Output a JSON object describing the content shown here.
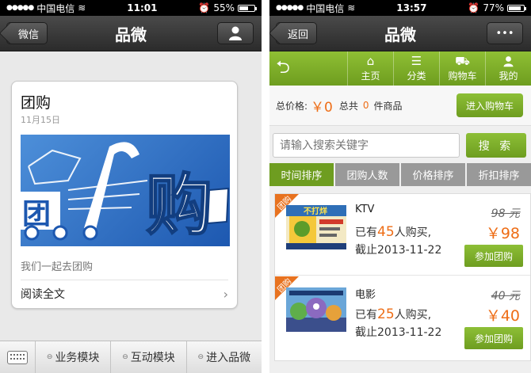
{
  "left_phone": {
    "status_bar": {
      "carrier": "中国电信",
      "time": "11:01",
      "battery_percent": "55%",
      "battery_level": 0.55
    },
    "nav": {
      "back_label": "微信",
      "title": "品微",
      "right_icon": "person-icon"
    },
    "article": {
      "title": "团购",
      "date": "11月15日",
      "banner_text_left": "团",
      "banner_text_right": "购",
      "description": "我们一起去团购",
      "read_more_label": "阅读全文",
      "colors": {
        "banner_blue": "#2a6bc4"
      }
    },
    "bottom_menu": {
      "keyboard_icon": "keyboard-icon",
      "items": [
        {
          "label": "业务模块"
        },
        {
          "label": "互动模块"
        },
        {
          "label": "进入品微"
        }
      ]
    }
  },
  "right_phone": {
    "status_bar": {
      "carrier": "中国电信",
      "time": "13:57",
      "battery_percent": "77%",
      "battery_level": 0.77
    },
    "nav": {
      "back_label": "返回",
      "title": "品微",
      "more_label": "•••"
    },
    "toolbar": {
      "back_icon": "undo-arrow-icon",
      "tabs": [
        {
          "label": "主页",
          "icon": "home-icon"
        },
        {
          "label": "分类",
          "icon": "list-icon"
        },
        {
          "label": "购物车",
          "icon": "cart-icon"
        },
        {
          "label": "我的",
          "icon": "person-icon"
        }
      ]
    },
    "summary": {
      "total_label": "总价格:",
      "total_value": "￥0",
      "count_prefix": "总共",
      "count_value": "0",
      "count_suffix": "件商品",
      "cart_button": "进入购物车"
    },
    "search": {
      "placeholder": "请输入搜索关键字",
      "button": "搜 索"
    },
    "sort_tabs": [
      {
        "label": "时间排序",
        "active": true
      },
      {
        "label": "团购人数",
        "active": false
      },
      {
        "label": "价格排序",
        "active": false
      },
      {
        "label": "折扣排序",
        "active": false
      }
    ],
    "deals": [
      {
        "ribbon": "团购",
        "name": "KTV",
        "buyers_prefix": "已有",
        "buyers_count": "45",
        "buyers_suffix": "人购买,",
        "expiry": "截止2013-11-22",
        "original_price": "98 元",
        "price": "￥98",
        "button": "参加团购",
        "poster_text": "不打烊"
      },
      {
        "ribbon": "团购",
        "name": "电影",
        "buyers_prefix": "已有",
        "buyers_count": "25",
        "buyers_suffix": "人购买,",
        "expiry": "截止2013-11-22",
        "original_price": "40 元",
        "price": "￥40",
        "button": "参加团购"
      }
    ],
    "colors": {
      "green": "#7aab2a",
      "orange": "#ee6d16"
    }
  }
}
